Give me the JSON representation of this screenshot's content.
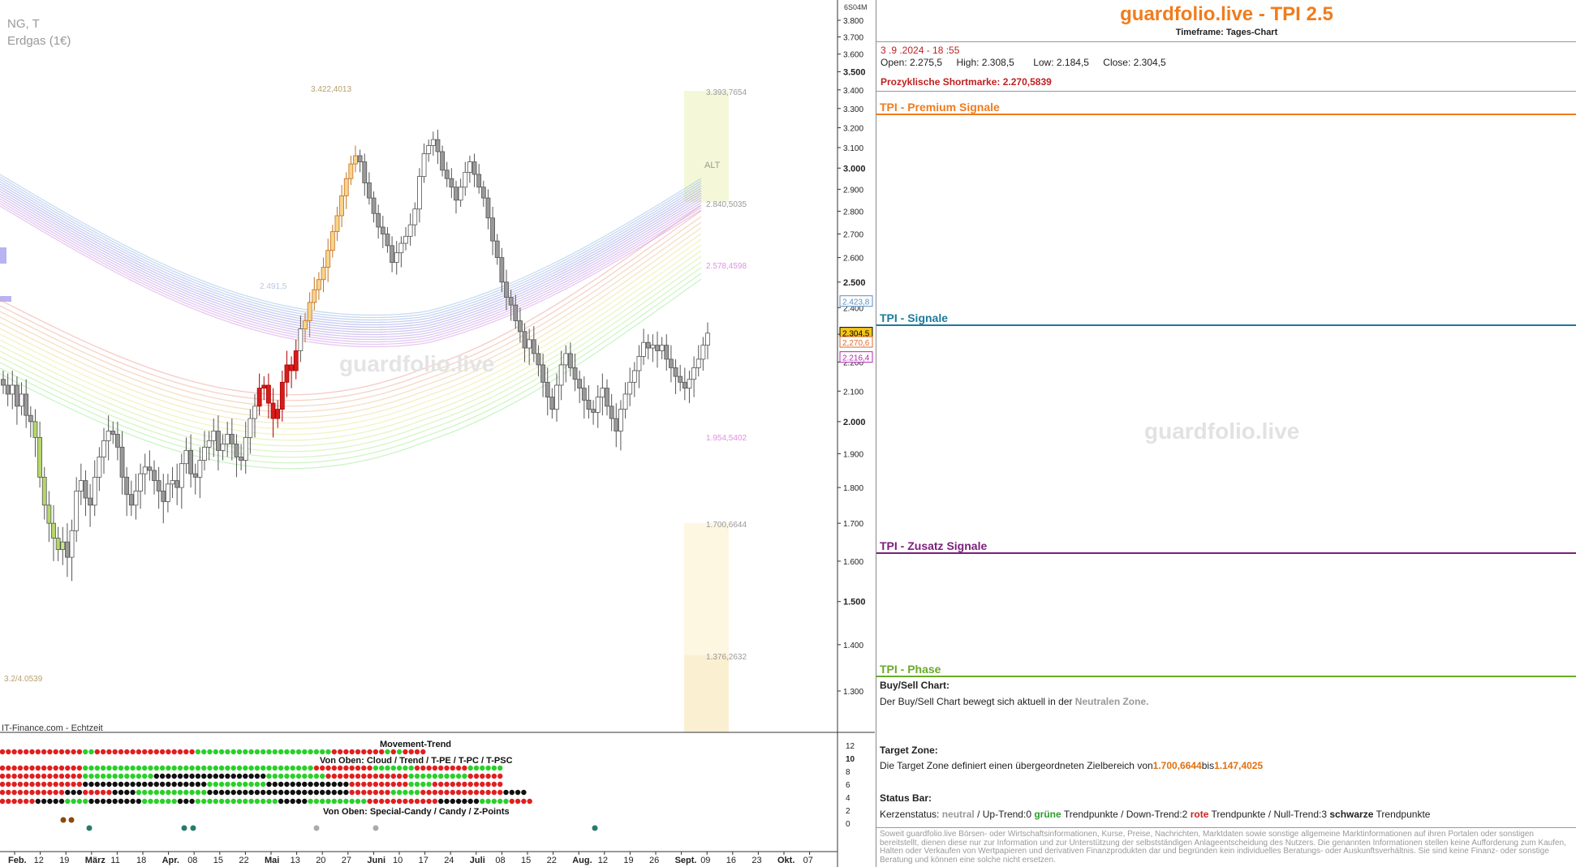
{
  "symbol": "NG, T",
  "instrument": "Erdgas (1€)",
  "source": "IT-Finance.com - Echtzeit",
  "chart_watermark": "guardfolio.live",
  "panel": {
    "title": "guardfolio.live - TPI 2.5",
    "timeframe": "Timeframe: Tages-Chart",
    "datetime": "3 .9 .2024  - 18 :55",
    "ohlc": {
      "open_label": "Open:",
      "open": "2.275,5",
      "high_label": "High:",
      "high": "2.308,5",
      "low_label": "Low:",
      "low": "2.184,5",
      "close_label": "Close:",
      "close": "2.304,5"
    },
    "short_label": "Prozyklische Shortmarke:",
    "short_value": "2.270,5839",
    "sections": [
      {
        "label": "TPI - Premium Signale",
        "color": "#f07c1c"
      },
      {
        "label": "TPI - Signale",
        "color": "#1e7a9c"
      },
      {
        "label": "TPI - Zusatz Signale",
        "color": "#7a1f7a"
      },
      {
        "label": "TPI - Phase",
        "color": "#6aaa2a"
      }
    ],
    "watermark": "guardfolio.live",
    "buysell_heading": "Buy/Sell Chart:",
    "buysell_text": "Der Buy/Sell Chart bewegt sich aktuell in der",
    "buysell_zone": "Neutralen Zone.",
    "target_heading": "Target Zone:",
    "target_text": "Die Target Zone definiert einen übergeordneten Zielbereich von",
    "target_from": "1.700,6644",
    "target_mid": "bis",
    "target_to": "1.147,4025",
    "status_heading": "Status Bar:",
    "status_kerzen_label": "Kerzenstatus:",
    "status_kerzen_value": "neutral",
    "status_up": "/ Up-Trend:0",
    "status_up_word": "grüne",
    "status_up_tail": "Trendpunkte",
    "status_down": "/ Down-Trend:2",
    "status_down_word": "rote",
    "status_down_tail": "Trendpunkte",
    "status_null": "/ Null-Trend:3",
    "status_null_word": "schwarze",
    "status_null_tail": "Trendpunkte",
    "disclaimer": "Soweit guardfolio.live Börsen- oder Wirtschaftsinformationen, Kurse, Preise, Nachrichten, Marktdaten sowie sonstige allgemeine Marktinformationen auf ihren Portalen oder sonstigen bereitstellt, dienen diese nur zur Information und zur Unterstützung der selbstständigen Anlageentscheidung des Nutzers. Die genannten Informationen stellen keine Aufforderung zum Kaufen, Halten oder Verkaufen von Wertpapieren und derivativen Finanzprodukten dar und begründen kein individuelles Beratungs- oder Auskunftsverhältnis. Sie sind keine Finanz- oder sonstige Beratung und können eine solche nicht ersetzen."
  },
  "chart_data": {
    "type": "candlestick",
    "y_axis_label_top": "6S04M",
    "yticks": [
      "3.800",
      "3.700",
      "3.600",
      "3.500",
      "3.400",
      "3.300",
      "3.200",
      "3.100",
      "3.000",
      "2.900",
      "2.800",
      "2.700",
      "2.600",
      "2.500",
      "2.400",
      "2.300",
      "2.200",
      "2.100",
      "2.000",
      "1.900",
      "1.800",
      "1.700",
      "1.600",
      "1.500",
      "1.400",
      "1.300"
    ],
    "ylim": [
      1.24,
      3.86
    ],
    "price_tags": [
      {
        "value": 2.4238,
        "label": "2.423,8",
        "color": "#5a8fc0",
        "bg": "#ffffff"
      },
      {
        "value": 2.3045,
        "label": "2.304,5",
        "color": "#000000",
        "bg": "#f5c518"
      },
      {
        "value": 2.2706,
        "label": "2,270,6",
        "color": "#e06a2a",
        "bg": "#ffffff"
      },
      {
        "value": 2.2164,
        "label": "2.216,4",
        "color": "#b02ab0",
        "bg": "#ffffff"
      }
    ],
    "levels": [
      {
        "value": 3.4224,
        "label": "3.422,4013",
        "color": "#b8a070"
      },
      {
        "value": 3.3938,
        "label": "3.393,7654",
        "color": "#999999"
      },
      {
        "value": 2.8405,
        "label": "2.840,5035",
        "color": "#999999"
      },
      {
        "value": 2.5785,
        "label": "2.578,4598",
        "color": "#e58de5"
      },
      {
        "value": 2.4915,
        "label": "2.491,5",
        "color": "#b9c8e0"
      },
      {
        "value": 1.9545,
        "label": "1.954,5402",
        "color": "#e58de5"
      },
      {
        "value": 1.7007,
        "label": "1.700,6644",
        "color": "#999999"
      },
      {
        "value": 1.3763,
        "label": "1.376,2632",
        "color": "#999999"
      },
      {
        "value": 1.32,
        "label": "3.2/4.0539",
        "color": "#b8a070"
      }
    ],
    "zone_label": "ALT",
    "x_labels": [
      "Feb.",
      "12",
      "19",
      "März",
      "11",
      "18",
      "Apr.",
      "08",
      "15",
      "22",
      "Mai",
      "13",
      "20",
      "27",
      "Juni",
      "10",
      "17",
      "24",
      "Juli",
      "08",
      "15",
      "22",
      "Aug.",
      "12",
      "19",
      "26",
      "Sept.",
      "09",
      "16",
      "23",
      "Okt.",
      "07"
    ],
    "x_bold": [
      "Feb.",
      "März",
      "Apr.",
      "Mai",
      "Juni",
      "Juli",
      "Aug.",
      "Sept.",
      "Okt."
    ],
    "closes": [
      2.12,
      2.09,
      2.12,
      2.05,
      2.09,
      2.02,
      2.0,
      1.95,
      1.83,
      1.75,
      1.7,
      1.66,
      1.63,
      1.65,
      1.61,
      1.68,
      1.79,
      1.82,
      1.77,
      1.75,
      1.83,
      1.89,
      1.94,
      1.97,
      1.96,
      1.92,
      1.83,
      1.78,
      1.75,
      1.79,
      1.84,
      1.86,
      1.85,
      1.82,
      1.79,
      1.76,
      1.81,
      1.82,
      1.8,
      1.87,
      1.91,
      1.84,
      1.83,
      1.88,
      1.92,
      1.94,
      1.97,
      1.91,
      1.93,
      1.96,
      1.93,
      1.89,
      1.88,
      1.95,
      2.01,
      2.05,
      2.11,
      2.12,
      2.06,
      2.01,
      2.04,
      2.13,
      2.19,
      2.17,
      2.24,
      2.32,
      2.35,
      2.42,
      2.47,
      2.51,
      2.56,
      2.63,
      2.71,
      2.78,
      2.87,
      2.95,
      3.02,
      3.06,
      3.03,
      2.93,
      2.86,
      2.79,
      2.73,
      2.7,
      2.65,
      2.58,
      2.62,
      2.66,
      2.69,
      2.74,
      2.81,
      2.96,
      3.07,
      3.11,
      3.14,
      3.08,
      2.99,
      2.95,
      2.91,
      2.85,
      2.91,
      2.98,
      3.03,
      2.97,
      2.91,
      2.86,
      2.77,
      2.67,
      2.6,
      2.5,
      2.44,
      2.41,
      2.35,
      2.31,
      2.25,
      2.28,
      2.23,
      2.19,
      2.13,
      2.08,
      2.04,
      2.12,
      2.19,
      2.23,
      2.18,
      2.14,
      2.11,
      2.07,
      2.04,
      2.03,
      2.08,
      2.11,
      2.05,
      2.01,
      1.97,
      2.04,
      2.09,
      2.13,
      2.17,
      2.22,
      2.27,
      2.25,
      2.26,
      2.24,
      2.26,
      2.21,
      2.18,
      2.15,
      2.13,
      2.11,
      2.14,
      2.18,
      2.21,
      2.26,
      2.304
    ],
    "trend_rows": [
      {
        "label": "Movement-Trend",
        "segments": [
          [
            "r",
            60
          ],
          [
            "g",
            7
          ],
          [
            "r",
            73
          ],
          [
            "g",
            97
          ],
          [
            "r",
            36
          ],
          [
            "g",
            2
          ],
          [
            "r",
            2
          ],
          [
            "g",
            3
          ],
          [
            "r",
            15
          ]
        ]
      },
      {
        "label": "Von Oben: Cloud / Trend / T-PE / T-PC / T-PSC",
        "segments": [
          [
            "r",
            60
          ],
          [
            "g",
            55
          ],
          [
            "g",
            110
          ],
          [
            "r",
            40
          ],
          [
            "g",
            30
          ],
          [
            "r",
            35
          ],
          [
            "g",
            25
          ]
        ]
      },
      {
        "label": "",
        "segments": [
          [
            "r",
            60
          ],
          [
            "g",
            50
          ],
          [
            "k",
            80
          ],
          [
            "g",
            40
          ],
          [
            "r",
            60
          ],
          [
            "g",
            40
          ],
          [
            "r",
            25
          ]
        ]
      },
      {
        "label": "",
        "segments": [
          [
            "r",
            60
          ],
          [
            "k",
            90
          ],
          [
            "g",
            40
          ],
          [
            "k",
            60
          ],
          [
            "r",
            40
          ],
          [
            "g",
            15
          ],
          [
            "r",
            50
          ]
        ]
      },
      {
        "label": "",
        "segments": [
          [
            "r",
            45
          ],
          [
            "k",
            10
          ],
          [
            "r",
            20
          ],
          [
            "k",
            15
          ],
          [
            "g",
            50
          ],
          [
            "k",
            100
          ],
          [
            "r",
            30
          ],
          [
            "g",
            20
          ],
          [
            "r",
            60
          ],
          [
            "k",
            15
          ]
        ]
      },
      {
        "label": "",
        "segments": [
          [
            "r",
            25
          ],
          [
            "k",
            20
          ],
          [
            "g",
            15
          ],
          [
            "k",
            35
          ],
          [
            "g",
            25
          ],
          [
            "k",
            10
          ],
          [
            "g",
            60
          ],
          [
            "k",
            20
          ],
          [
            "g",
            40
          ],
          [
            "r",
            50
          ],
          [
            "k",
            30
          ],
          [
            "g",
            20
          ],
          [
            "r",
            15
          ]
        ]
      }
    ],
    "bottom_row_label": "Von Oben: Special-Candy / Candy / Z-Points",
    "sub_yticks": [
      "12",
      "10",
      "8",
      "6",
      "4",
      "2",
      "0"
    ]
  }
}
